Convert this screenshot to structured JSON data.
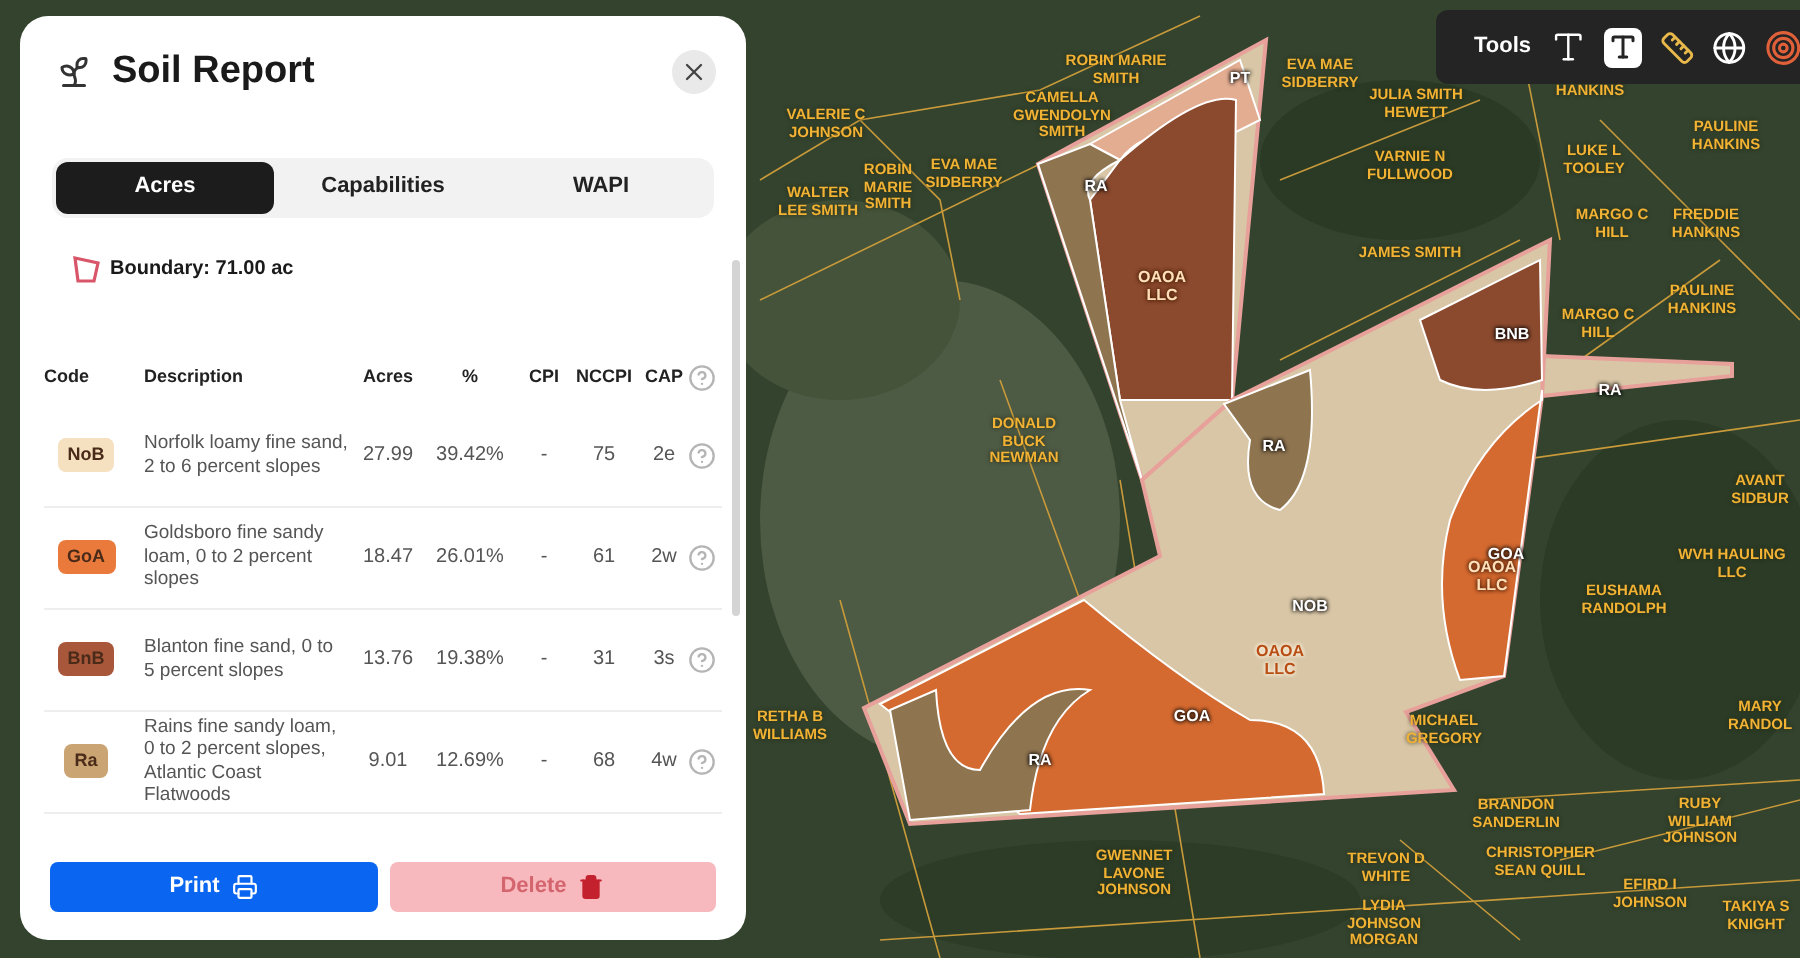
{
  "panel": {
    "title": "Soil Report",
    "tabs": [
      {
        "label": "Acres",
        "selected": true
      },
      {
        "label": "Capabilities",
        "selected": false
      },
      {
        "label": "WAPI",
        "selected": false
      }
    ],
    "boundary": "Boundary: 71.00 ac",
    "columns": [
      "Code",
      "Description",
      "Acres",
      "%",
      "CPI",
      "NCCPI",
      "CAP"
    ],
    "rows": [
      {
        "code": "NoB",
        "color": "#f5e0c0",
        "description": "Norfolk loamy fine sand, 2 to 6 percent slopes",
        "acres": "27.99",
        "percent": "39.42%",
        "cpi": "-",
        "nccpi": "75",
        "cap": "2e"
      },
      {
        "code": "GoA",
        "color": "#ea7a3c",
        "description": "Goldsboro fine sandy loam, 0 to 2 percent slopes",
        "acres": "18.47",
        "percent": "26.01%",
        "cpi": "-",
        "nccpi": "61",
        "cap": "2w"
      },
      {
        "code": "BnB",
        "color": "#a8573a",
        "description": "Blanton fine sand, 0 to 5 percent slopes",
        "acres": "13.76",
        "percent": "19.38%",
        "cpi": "-",
        "nccpi": "31",
        "cap": "3s"
      },
      {
        "code": "Ra",
        "color": "#caa473",
        "description": "Rains fine sandy loam, 0 to 2 percent slopes, Atlantic Coast Flatwoods",
        "acres": "9.01",
        "percent": "12.69%",
        "cpi": "-",
        "nccpi": "68",
        "cap": "4w"
      }
    ],
    "buttons": [
      {
        "label": "Print",
        "kind": "print",
        "disabled": false
      },
      {
        "label": "Delete",
        "kind": "delete",
        "disabled": true
      }
    ]
  },
  "toolbar": {
    "label": "Tools"
  },
  "map": {
    "soil_labels": [
      "PT",
      "RA",
      "BNB",
      "RA",
      "RA",
      "NOB",
      "GOA",
      "GOA",
      "RA"
    ],
    "owner_labels": [
      "OAOA LLC",
      "OAOA LLC",
      "OAOA LLC"
    ],
    "parcel_labels": [
      "ROBIN MARIE SMITH",
      "CAMELLA GWENDOLYN SMITH",
      "EVA MAE SIDBERRY",
      "JULIA SMITH HEWETT",
      "HANKINS",
      "PAULINE HANKINS",
      "LUKE L TOOLEY",
      "MARGO C HILL",
      "FREDDIE HANKINS",
      "MARGO C HILL",
      "PAULINE HANKINS",
      "VARNIE N FULLWOOD",
      "JAMES SMITH",
      "VALERIE C JOHNSON",
      "WALTER LEE SMITH",
      "ROBIN MARIE SMITH",
      "EVA MAE SIDBERRY",
      "DONALD BUCK NEWMAN",
      "RETHA B WILLIAMS",
      "GWENNET LAVONE JOHNSON",
      "TREVON D WHITE",
      "LYDIA JOHNSON MORGAN",
      "BRANDON SANDERLIN",
      "CHRISTOPHER SEAN QUILL",
      "RUBY WILLIAM JOHNSON",
      "EFIRD I JOHNSON",
      "MICHAEL GREGORY",
      "EUSHAMA RANDOLPH",
      "AVANT SIDBUR",
      "WVH HAULING LLC",
      "MARY RANDOL",
      "TAKIYA S KNIGHT"
    ]
  }
}
